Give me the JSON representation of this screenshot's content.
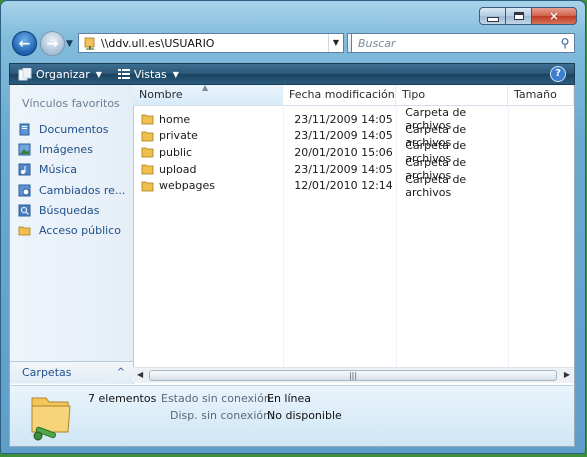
{
  "window": {
    "caption": {
      "minimize": "minimize",
      "maximize": "maximize",
      "close": "×"
    }
  },
  "nav": {
    "address": "\\\\ddv.ull.es\\USUARIO",
    "search_placeholder": "Buscar"
  },
  "toolbar": {
    "organize": "Organizar",
    "views": "Vistas",
    "help": "?"
  },
  "sidebar": {
    "title": "Vínculos favoritos",
    "items": [
      {
        "label": "Documentos",
        "icon": "documents-icon",
        "color": "#3a78c6"
      },
      {
        "label": "Imágenes",
        "icon": "pictures-icon",
        "color": "#4a8fcf"
      },
      {
        "label": "Música",
        "icon": "music-icon",
        "color": "#3b73b8"
      },
      {
        "label": "Cambiados re...",
        "icon": "recent-changes-icon",
        "color": "#4c86c4"
      },
      {
        "label": "Búsquedas",
        "icon": "searches-icon",
        "color": "#3a6fb0"
      },
      {
        "label": "Acceso público",
        "icon": "folder-icon",
        "color": "#e8b43a"
      }
    ],
    "folders_label": "Carpetas"
  },
  "file_list": {
    "columns": [
      "Nombre",
      "Fecha modificación",
      "Tipo",
      "Tamaño"
    ],
    "rows": [
      {
        "name": "home",
        "date": "23/11/2009 14:05",
        "type": "Carpeta de archivos"
      },
      {
        "name": "private",
        "date": "23/11/2009 14:05",
        "type": "Carpeta de archivos"
      },
      {
        "name": "public",
        "date": "20/01/2010 15:06",
        "type": "Carpeta de archivos"
      },
      {
        "name": "upload",
        "date": "23/11/2009 14:05",
        "type": "Carpeta de archivos"
      },
      {
        "name": "webpages",
        "date": "12/01/2010 12:14",
        "type": "Carpeta de archivos"
      }
    ]
  },
  "details": {
    "count": "7 elementos",
    "offline_status_label": "Estado sin conexión:",
    "offline_status_value": "En línea",
    "offline_avail_label": "Disp. sin conexión:",
    "offline_avail_value": "No disponible"
  },
  "colors": {
    "folder": "#e8b43a",
    "toolbar": "#2b5677",
    "link": "#1f4f8a"
  }
}
